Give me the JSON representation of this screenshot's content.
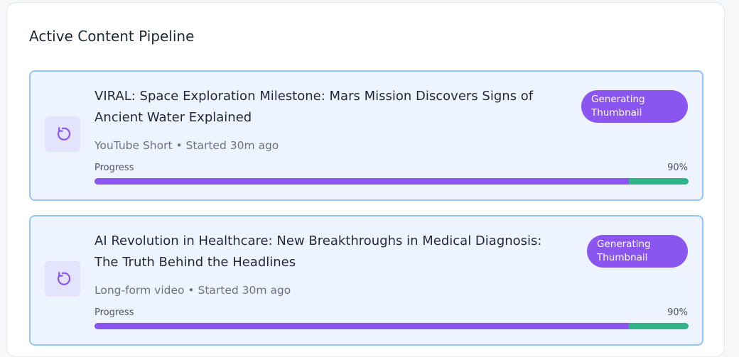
{
  "pipeline": {
    "title": "Active Content Pipeline",
    "items": [
      {
        "title": "VIRAL: Space Exploration Milestone: Mars Mission Discovers Signs of Ancient Water Explained",
        "meta": "YouTube Short • Started 30m ago",
        "status": "Generating Thumbnail",
        "progress_label": "Progress",
        "progress_text": "90%",
        "progress": 0.9,
        "icon": "refresh-icon"
      },
      {
        "title": "AI Revolution in Healthcare: New Breakthroughs in Medical Diagnosis: The Truth Behind the Headlines",
        "meta": "Long-form video • Started 30m ago",
        "status": "Generating Thumbnail",
        "progress_label": "Progress",
        "progress_text": "90%",
        "progress": 0.9,
        "icon": "refresh-icon"
      }
    ]
  },
  "colors": {
    "accent": "#8b55f0",
    "progress_remaining": "#2fb48a",
    "card_border": "#93c5fd",
    "card_background": "#eef4ff"
  }
}
